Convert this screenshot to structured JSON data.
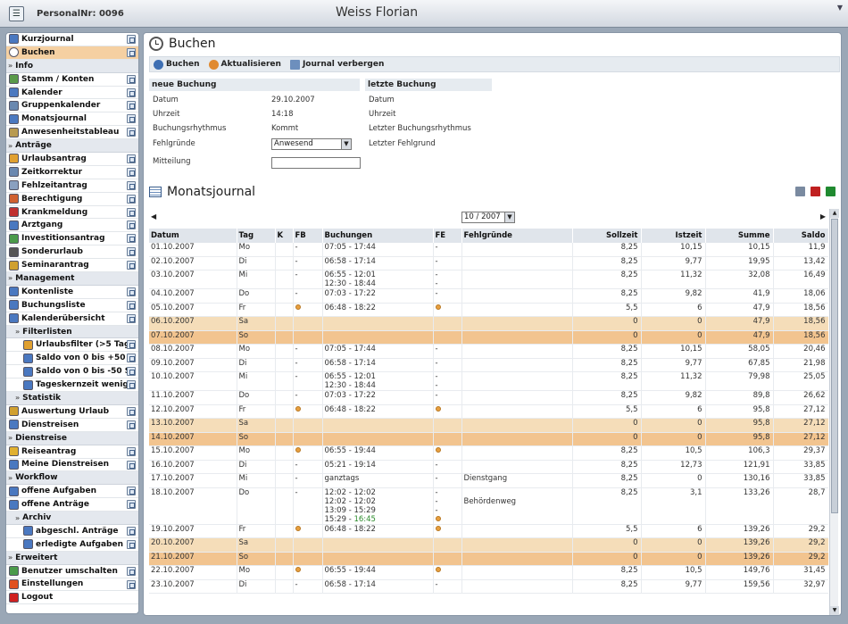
{
  "header": {
    "personalnr": "PersonalNr: 0096",
    "name": "Weiss Florian"
  },
  "sidebar": [
    {
      "kind": "item",
      "label": "Kurzjournal",
      "icon": "journal-icon",
      "color": "#4a78c0",
      "exp": true
    },
    {
      "kind": "item",
      "label": "Buchen",
      "icon": "clock-icon",
      "color": "#ffffff",
      "active": true,
      "exp": true
    },
    {
      "kind": "section",
      "label": "Info"
    },
    {
      "kind": "item",
      "label": "Stamm / Konten",
      "icon": "people-icon",
      "color": "#5a9a4a",
      "exp": true
    },
    {
      "kind": "item",
      "label": "Kalender",
      "icon": "calendar-icon",
      "color": "#4a78c0",
      "exp": true
    },
    {
      "kind": "item",
      "label": "Gruppenkalender",
      "icon": "calendar-icon",
      "color": "#6a88b0",
      "exp": true
    },
    {
      "kind": "item",
      "label": "Monatsjournal",
      "icon": "list-icon",
      "color": "#4a78c0",
      "exp": true
    },
    {
      "kind": "item",
      "label": "Anwesenheitstableau",
      "icon": "tableau-icon",
      "color": "#b89a50",
      "exp": true
    },
    {
      "kind": "section",
      "label": "Anträge"
    },
    {
      "kind": "item",
      "label": "Urlaubsantrag",
      "icon": "vacation-icon",
      "color": "#e0a030",
      "exp": true
    },
    {
      "kind": "item",
      "label": "Zeitkorrektur",
      "icon": "clock-icon",
      "color": "#6a88b0",
      "exp": true
    },
    {
      "kind": "item",
      "label": "Fehlzeitantrag",
      "icon": "document-icon",
      "color": "#8aa0c0",
      "exp": true
    },
    {
      "kind": "item",
      "label": "Berechtigung",
      "icon": "key-icon",
      "color": "#d06030",
      "exp": true
    },
    {
      "kind": "item",
      "label": "Krankmeldung",
      "icon": "medical-icon",
      "color": "#c03030",
      "exp": true
    },
    {
      "kind": "item",
      "label": "Arztgang",
      "icon": "doctor-icon",
      "color": "#4a78c0",
      "exp": true
    },
    {
      "kind": "item",
      "label": "Investitionsantrag",
      "icon": "money-icon",
      "color": "#4a9a4a",
      "exp": true
    },
    {
      "kind": "item",
      "label": "Sonderurlaub",
      "icon": "special-icon",
      "color": "#555555",
      "exp": true
    },
    {
      "kind": "item",
      "label": "Seminarantrag",
      "icon": "seminar-icon",
      "color": "#d0a030",
      "exp": true
    },
    {
      "kind": "section",
      "label": "Management"
    },
    {
      "kind": "item",
      "label": "Kontenliste",
      "icon": "list-icon",
      "color": "#4a78c0",
      "exp": true
    },
    {
      "kind": "item",
      "label": "Buchungsliste",
      "icon": "list-icon",
      "color": "#4a78c0",
      "exp": true
    },
    {
      "kind": "item",
      "label": "Kalenderübersicht",
      "icon": "calendar-icon",
      "color": "#4a78c0",
      "exp": true
    },
    {
      "kind": "section",
      "label": "Filterlisten",
      "indent": 1
    },
    {
      "kind": "item",
      "label": "Urlaubsfilter (>5 Tag",
      "icon": "vacation-icon",
      "color": "#e0a030",
      "exp": true,
      "indent": 2
    },
    {
      "kind": "item",
      "label": "Saldo von 0 bis +50 S",
      "icon": "list-icon",
      "color": "#4a78c0",
      "exp": true,
      "indent": 2
    },
    {
      "kind": "item",
      "label": "Saldo von 0 bis -50 S",
      "icon": "list-icon",
      "color": "#4a78c0",
      "exp": true,
      "indent": 2
    },
    {
      "kind": "item",
      "label": "Tageskernzeit wenige",
      "icon": "list-icon",
      "color": "#4a78c0",
      "exp": true,
      "indent": 2
    },
    {
      "kind": "section",
      "label": "Statistik",
      "indent": 1
    },
    {
      "kind": "item",
      "label": "Auswertung Urlaub",
      "icon": "chart-icon",
      "color": "#d0a030",
      "exp": true
    },
    {
      "kind": "item",
      "label": "Dienstreisen",
      "icon": "travel-icon",
      "color": "#4a78c0",
      "exp": true
    },
    {
      "kind": "section",
      "label": "Dienstreise"
    },
    {
      "kind": "item",
      "label": "Reiseantrag",
      "icon": "travel-icon",
      "color": "#e0b030",
      "exp": true
    },
    {
      "kind": "item",
      "label": "Meine Dienstreisen",
      "icon": "list-icon",
      "color": "#4a78c0",
      "exp": true
    },
    {
      "kind": "section",
      "label": "Workflow"
    },
    {
      "kind": "item",
      "label": "offene Aufgaben",
      "icon": "task-icon",
      "color": "#4a78c0",
      "exp": true
    },
    {
      "kind": "item",
      "label": "offene Anträge",
      "icon": "task-icon",
      "color": "#4a78c0",
      "exp": true
    },
    {
      "kind": "section",
      "label": "Archiv",
      "indent": 1
    },
    {
      "kind": "item",
      "label": "abgeschl. Anträge",
      "icon": "check-icon",
      "color": "#4a78c0",
      "exp": true,
      "indent": 2
    },
    {
      "kind": "item",
      "label": "erledigte Aufgaben",
      "icon": "check-icon",
      "color": "#4a78c0",
      "exp": true,
      "indent": 2
    },
    {
      "kind": "section",
      "label": "Erweitert"
    },
    {
      "kind": "item",
      "label": "Benutzer umschalten",
      "icon": "switch-user-icon",
      "color": "#4a9a4a",
      "exp": true
    },
    {
      "kind": "item",
      "label": "Einstellungen",
      "icon": "settings-icon",
      "color": "#e05020",
      "exp": true
    },
    {
      "kind": "item",
      "label": "Logout",
      "icon": "logout-icon",
      "color": "#d02020",
      "exp": false
    }
  ],
  "buchen": {
    "title": "Buchen",
    "toolbar": [
      "Buchen",
      "Aktualisieren",
      "Journal verbergen"
    ],
    "neue_title": "neue Buchung",
    "letzte_title": "letzte Buchung",
    "fields": [
      {
        "label": "Datum",
        "value": "29.10.2007"
      },
      {
        "label": "Uhrzeit",
        "value": "14:18"
      },
      {
        "label": "Buchungsrhythmus",
        "value": "Kommt"
      }
    ],
    "fehl_label": "Fehlgründe",
    "fehl_value": "Anwesend",
    "mitteilung_label": "Mitteilung",
    "letzte_labels": [
      "Datum",
      "Uhrzeit",
      "Letzter Buchungsrhythmus",
      "Letzter Fehlgrund"
    ]
  },
  "journal": {
    "title": "Monatsjournal",
    "month": "10 / 2007",
    "columns": [
      "Datum",
      "Tag",
      "K",
      "FB",
      "Buchungen",
      "FE",
      "Fehlgründe",
      "Sollzeit",
      "Istzeit",
      "Summe",
      "Saldo"
    ],
    "rows": [
      {
        "d": "01.10.2007",
        "t": "Mo",
        "fb": "-",
        "b": [
          "07:05 - 17:44"
        ],
        "fe": "-",
        "f": "",
        "s": "8,25",
        "i": "10,15",
        "su": "10,15",
        "sa": "11,9"
      },
      {
        "d": "02.10.2007",
        "t": "Di",
        "fb": "-",
        "b": [
          "06:58 - 17:14"
        ],
        "fe": "-",
        "f": "",
        "s": "8,25",
        "i": "9,77",
        "su": "19,95",
        "sa": "13,42"
      },
      {
        "d": "03.10.2007",
        "t": "Mi",
        "fb": "-",
        "b": [
          "06:55 - 12:01",
          "12:30 - 18:44"
        ],
        "fe": "-",
        "f": "",
        "s": "8,25",
        "i": "11,32",
        "su": "32,08",
        "sa": "16,49"
      },
      {
        "d": "04.10.2007",
        "t": "Do",
        "fb": "-",
        "b": [
          "07:03 - 17:22"
        ],
        "fe": "-",
        "f": "",
        "s": "8,25",
        "i": "9,82",
        "su": "41,9",
        "sa": "18,06"
      },
      {
        "d": "05.10.2007",
        "t": "Fr",
        "fb": "dot",
        "b": [
          "06:48 - 18:22"
        ],
        "fe": "dot",
        "f": "",
        "s": "5,5",
        "i": "6",
        "su": "47,9",
        "sa": "18,56"
      },
      {
        "d": "06.10.2007",
        "t": "Sa",
        "fb": "",
        "b": [
          ""
        ],
        "fe": "",
        "f": "",
        "s": "0",
        "i": "0",
        "su": "47,9",
        "sa": "18,56",
        "we": 1
      },
      {
        "d": "07.10.2007",
        "t": "So",
        "fb": "",
        "b": [
          ""
        ],
        "fe": "",
        "f": "",
        "s": "0",
        "i": "0",
        "su": "47,9",
        "sa": "18,56",
        "we": 2
      },
      {
        "d": "08.10.2007",
        "t": "Mo",
        "fb": "-",
        "b": [
          "07:05 - 17:44"
        ],
        "fe": "-",
        "f": "",
        "s": "8,25",
        "i": "10,15",
        "su": "58,05",
        "sa": "20,46"
      },
      {
        "d": "09.10.2007",
        "t": "Di",
        "fb": "-",
        "b": [
          "06:58 - 17:14"
        ],
        "fe": "-",
        "f": "",
        "s": "8,25",
        "i": "9,77",
        "su": "67,85",
        "sa": "21,98"
      },
      {
        "d": "10.10.2007",
        "t": "Mi",
        "fb": "-",
        "b": [
          "06:55 - 12:01",
          "12:30 - 18:44"
        ],
        "fe": "-",
        "f": "",
        "s": "8,25",
        "i": "11,32",
        "su": "79,98",
        "sa": "25,05"
      },
      {
        "d": "11.10.2007",
        "t": "Do",
        "fb": "-",
        "b": [
          "07:03 - 17:22"
        ],
        "fe": "-",
        "f": "",
        "s": "8,25",
        "i": "9,82",
        "su": "89,8",
        "sa": "26,62"
      },
      {
        "d": "12.10.2007",
        "t": "Fr",
        "fb": "dot",
        "b": [
          "06:48 - 18:22"
        ],
        "fe": "dot",
        "f": "",
        "s": "5,5",
        "i": "6",
        "su": "95,8",
        "sa": "27,12"
      },
      {
        "d": "13.10.2007",
        "t": "Sa",
        "fb": "",
        "b": [
          ""
        ],
        "fe": "",
        "f": "",
        "s": "0",
        "i": "0",
        "su": "95,8",
        "sa": "27,12",
        "we": 1
      },
      {
        "d": "14.10.2007",
        "t": "So",
        "fb": "",
        "b": [
          ""
        ],
        "fe": "",
        "f": "",
        "s": "0",
        "i": "0",
        "su": "95,8",
        "sa": "27,12",
        "we": 2
      },
      {
        "d": "15.10.2007",
        "t": "Mo",
        "fb": "dot",
        "b": [
          "06:55 - 19:44"
        ],
        "fe": "dot",
        "f": "",
        "s": "8,25",
        "i": "10,5",
        "su": "106,3",
        "sa": "29,37"
      },
      {
        "d": "16.10.2007",
        "t": "Di",
        "fb": "-",
        "b": [
          "05:21 - 19:14"
        ],
        "fe": "-",
        "f": "",
        "s": "8,25",
        "i": "12,73",
        "su": "121,91",
        "sa": "33,85"
      },
      {
        "d": "17.10.2007",
        "t": "Mi",
        "fb": "-",
        "b": [
          "ganztags"
        ],
        "fe": "-",
        "f": "Dienstgang",
        "s": "8,25",
        "i": "0",
        "su": "130,16",
        "sa": "33,85"
      },
      {
        "d": "18.10.2007",
        "t": "Do",
        "fb": "-",
        "b": [
          "12:02 - 12:02",
          "12:02 - 12:02",
          "13:09 - 15:29",
          "15:29 - 16:45"
        ],
        "fe": "-",
        "f": "Behördenweg",
        "s": "8,25",
        "i": "3,1",
        "su": "133,26",
        "sa": "28,7",
        "tall": 1
      },
      {
        "d": "19.10.2007",
        "t": "Fr",
        "fb": "dot",
        "b": [
          "06:48 - 18:22"
        ],
        "fe": "dot",
        "f": "",
        "s": "5,5",
        "i": "6",
        "su": "139,26",
        "sa": "29,2"
      },
      {
        "d": "20.10.2007",
        "t": "Sa",
        "fb": "",
        "b": [
          ""
        ],
        "fe": "",
        "f": "",
        "s": "0",
        "i": "0",
        "su": "139,26",
        "sa": "29,2",
        "we": 1
      },
      {
        "d": "21.10.2007",
        "t": "So",
        "fb": "",
        "b": [
          ""
        ],
        "fe": "",
        "f": "",
        "s": "0",
        "i": "0",
        "su": "139,26",
        "sa": "29,2",
        "we": 2
      },
      {
        "d": "22.10.2007",
        "t": "Mo",
        "fb": "dot",
        "b": [
          "06:55 - 19:44"
        ],
        "fe": "dot",
        "f": "",
        "s": "8,25",
        "i": "10,5",
        "su": "149,76",
        "sa": "31,45"
      },
      {
        "d": "23.10.2007",
        "t": "Di",
        "fb": "-",
        "b": [
          "06:58 - 17:14"
        ],
        "fe": "-",
        "f": "",
        "s": "8,25",
        "i": "9,77",
        "su": "159,56",
        "sa": "32,97"
      }
    ]
  }
}
